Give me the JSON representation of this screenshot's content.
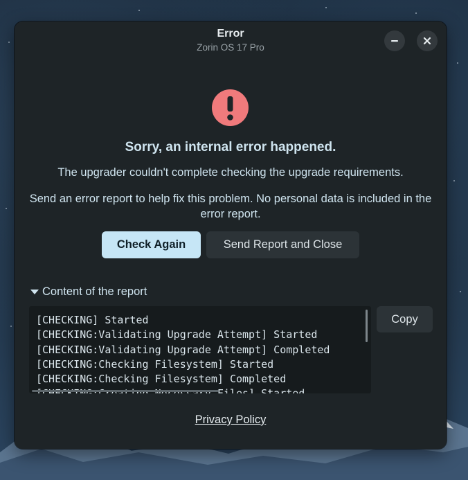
{
  "window": {
    "title": "Error",
    "subtitle": "Zorin OS 17 Pro",
    "minimize_icon": "minimize-icon",
    "close_icon": "close-icon"
  },
  "content": {
    "icon": "error-exclamation-icon",
    "icon_color": "#f07a7c",
    "headline": "Sorry, an internal error happened.",
    "message": "The upgrader couldn't complete checking the upgrade requirements.",
    "report_note": "Send an error report to help fix this problem. No personal data is included in the error report."
  },
  "actions": {
    "check_again": "Check Again",
    "send_report": "Send Report and Close"
  },
  "report": {
    "expander_label": "Content of the report",
    "expander_state": "expanded",
    "lines": [
      "[CHECKING] Started",
      "[CHECKING:Validating Upgrade Attempt] Started",
      "[CHECKING:Validating Upgrade Attempt] Completed",
      "[CHECKING:Checking Filesystem] Started",
      "[CHECKING:Checking Filesystem] Completed",
      "[CHECKING:Creating Necessary Files] Started"
    ],
    "copy_label": "Copy"
  },
  "footer": {
    "privacy_link": "Privacy Policy"
  },
  "colors": {
    "primary_button_bg": "#c6e6f6",
    "dialog_bg": "#1e2427"
  }
}
